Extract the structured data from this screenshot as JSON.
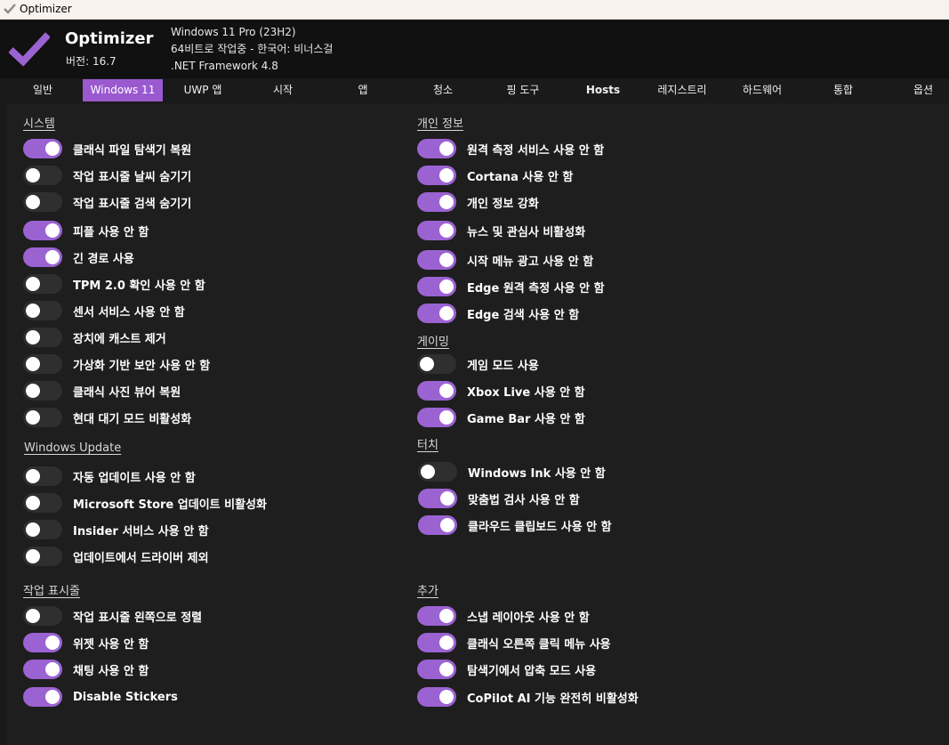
{
  "window": {
    "title": "Optimizer"
  },
  "header": {
    "app_name": "Optimizer",
    "version": "버전: 16.7",
    "os": "Windows 11 Pro (23H2)",
    "arch_lang": "64비트로 작업중 - 한국어: 비너스걸",
    "framework": ".NET Framework 4.8"
  },
  "tabs": [
    "일반",
    "Windows 11",
    "UWP 앱",
    "시작",
    "앱",
    "청소",
    "핑 도구",
    "Hosts",
    "레지스트리",
    "하드웨어",
    "통합",
    "옵션"
  ],
  "active_tab": "Windows 11",
  "colors": {
    "accent": "#9b63d2",
    "toggle_off": "#2f2f2f",
    "background": "#1e1e1e",
    "header": "#111111"
  },
  "sections": {
    "system": {
      "title": "시스템",
      "options": [
        {
          "label": "클래식 파일 탐색기 복원",
          "on": true
        },
        {
          "label": "작업 표시줄 날씨 숨기기",
          "on": false
        },
        {
          "label": "작업 표시줄 검색 숨기기",
          "on": false
        },
        {
          "label": "피플 사용 안 함",
          "on": true
        },
        {
          "label": "긴 경로 사용",
          "on": true
        },
        {
          "label": "TPM 2.0 확인 사용 안 함",
          "on": false
        },
        {
          "label": "센서 서비스 사용 안 함",
          "on": false
        },
        {
          "label": "장치에 캐스트 제거",
          "on": false
        },
        {
          "label": "가상화 기반 보안 사용 안 함",
          "on": false
        },
        {
          "label": "클래식 사진 뷰어 복원",
          "on": false
        },
        {
          "label": "현대 대기 모드 비활성화",
          "on": false
        }
      ]
    },
    "windows_update": {
      "title": "Windows Update",
      "options": [
        {
          "label": "자동 업데이트 사용 안 함",
          "on": false
        },
        {
          "label": "Microsoft Store 업데이트 비활성화",
          "on": false
        },
        {
          "label": "Insider 서비스 사용 안 함",
          "on": false
        },
        {
          "label": "업데이트에서 드라이버 제외",
          "on": false
        }
      ]
    },
    "taskbar": {
      "title": "작업 표시줄",
      "options": [
        {
          "label": "작업 표시줄 왼쪽으로 정렬",
          "on": false
        },
        {
          "label": "위젯 사용 안 함",
          "on": true
        },
        {
          "label": "채팅 사용 안 함",
          "on": true
        },
        {
          "label": "Disable Stickers",
          "on": true
        }
      ]
    },
    "privacy": {
      "title": "개인 정보",
      "options": [
        {
          "label": "원격 측정 서비스 사용 안 함",
          "on": true
        },
        {
          "label": "Cortana 사용 안 함",
          "on": true
        },
        {
          "label": "개인 정보 강화",
          "on": true
        },
        {
          "label": "뉴스 및 관심사 비활성화",
          "on": true
        },
        {
          "label": "시작 메뉴 광고 사용 안 함",
          "on": true
        },
        {
          "label": "Edge 원격 측정 사용 안 함",
          "on": true
        },
        {
          "label": "Edge 검색 사용 안 함",
          "on": true
        }
      ]
    },
    "gaming": {
      "title": "게이밍",
      "options": [
        {
          "label": "게임 모드 사용",
          "on": false
        },
        {
          "label": "Xbox Live 사용 안 함",
          "on": true
        },
        {
          "label": "Game Bar 사용 안 함",
          "on": true
        }
      ]
    },
    "touch": {
      "title": "터치",
      "options": [
        {
          "label": "Windows Ink 사용 안 함",
          "on": false
        },
        {
          "label": "맞춤법 검사 사용 안 함",
          "on": true
        },
        {
          "label": "클라우드 클립보드 사용 안 함",
          "on": true
        }
      ]
    },
    "extra": {
      "title": "추가",
      "options": [
        {
          "label": "스냅 레이아웃 사용 안 함",
          "on": true
        },
        {
          "label": "클래식 오른쪽 클릭 메뉴 사용",
          "on": true
        },
        {
          "label": "탐색기에서 압축 모드 사용",
          "on": true
        },
        {
          "label": "CoPilot AI 기능 완전히 비활성화",
          "on": true
        }
      ]
    }
  }
}
